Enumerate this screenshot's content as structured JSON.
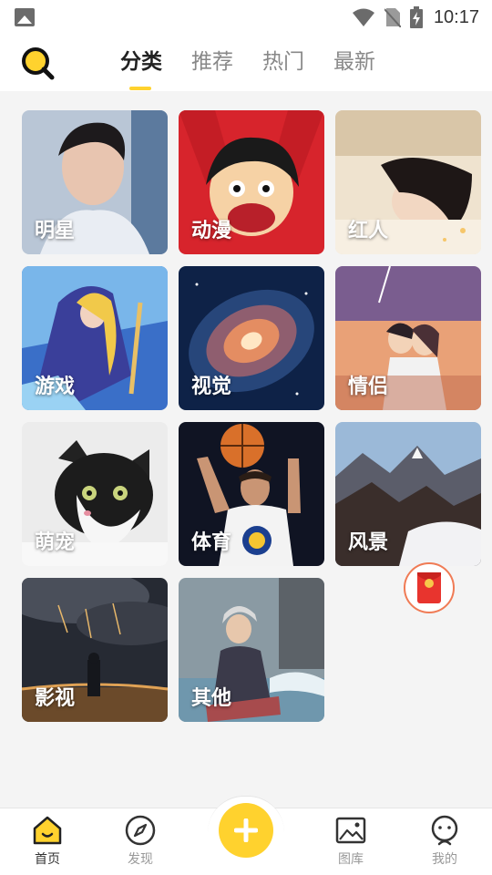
{
  "status_bar": {
    "time": "10:17"
  },
  "top_nav": {
    "tabs": [
      {
        "label": "分类",
        "active": true
      },
      {
        "label": "推荐",
        "active": false
      },
      {
        "label": "热门",
        "active": false
      },
      {
        "label": "最新",
        "active": false
      }
    ]
  },
  "categories": [
    {
      "label": "明星"
    },
    {
      "label": "动漫"
    },
    {
      "label": "红人"
    },
    {
      "label": "游戏"
    },
    {
      "label": "视觉"
    },
    {
      "label": "情侣"
    },
    {
      "label": "萌宠"
    },
    {
      "label": "体育"
    },
    {
      "label": "风景"
    },
    {
      "label": "影视"
    },
    {
      "label": "其他"
    }
  ],
  "bottom_nav": {
    "items": [
      {
        "label": "首页",
        "icon": "home-icon",
        "active": true
      },
      {
        "label": "发现",
        "icon": "compass-icon",
        "active": false
      },
      {
        "label": "图库",
        "icon": "gallery-icon",
        "active": false
      },
      {
        "label": "我的",
        "icon": "profile-icon",
        "active": false
      }
    ],
    "center_button_icon": "plus-icon"
  },
  "colors": {
    "accent": "#ffd22e",
    "active_text": "#222222",
    "inactive_text": "#888888",
    "background": "#f4f4f4"
  }
}
